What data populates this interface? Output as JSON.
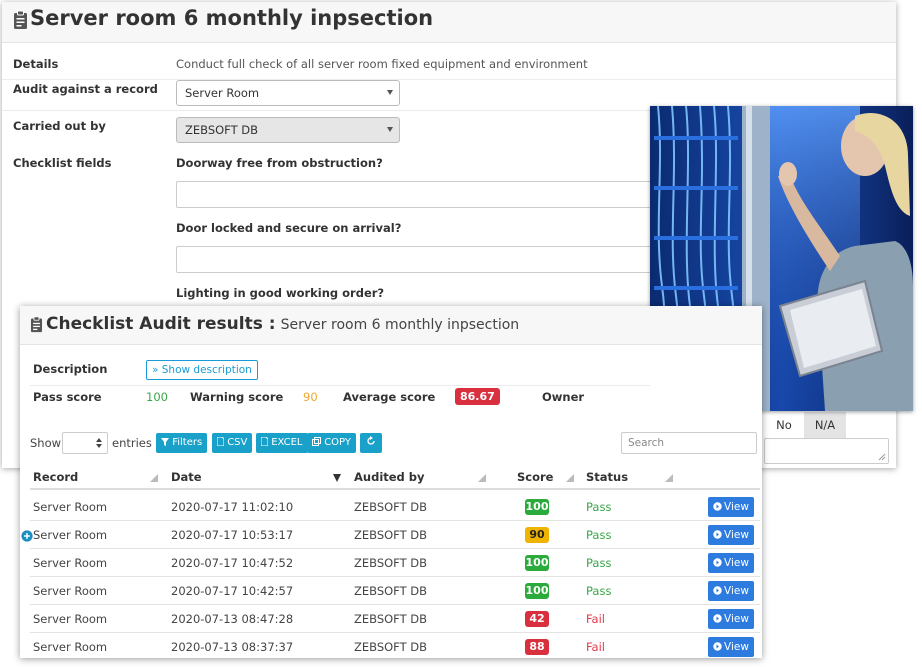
{
  "form": {
    "title": "Server room 6 monthly inpsection",
    "details_label": "Details",
    "details_value": "Conduct full check of all server room fixed equipment and environment",
    "audit_label": "Audit against a record",
    "audit_value": "Server Room",
    "carried_label": "Carried out by",
    "carried_value": "ZEBSOFT DB",
    "checklist_label": "Checklist fields",
    "q1": "Doorway free from obstruction?",
    "q2": "Door locked and secure on arrival?",
    "q3": "Lighting in good working order?",
    "no_label": "No",
    "na_label": "N/A"
  },
  "results": {
    "title": "Checklist Audit results :",
    "subtitle": "Server room 6 monthly inpsection",
    "description_label": "Description",
    "show_description": "» Show description",
    "pass_label": "Pass score",
    "pass_value": "100",
    "warning_label": "Warning score",
    "warning_value": "90",
    "average_label": "Average score",
    "average_value": "86.67",
    "owner_label": "Owner",
    "show_label": "Show",
    "entries_label": "entries",
    "filters": "Filters",
    "csv": "CSV",
    "excel": "EXCEL",
    "copy": "COPY",
    "search_placeholder": "Search",
    "columns": [
      "Record",
      "Date",
      "Audited by",
      "Score",
      "Status"
    ],
    "view_label": "View",
    "rows": [
      {
        "record": "Server Room",
        "date": "2020-07-17 11:02:10",
        "by": "ZEBSOFT DB",
        "score": "100",
        "status": "Pass"
      },
      {
        "record": "Server Room",
        "date": "2020-07-17 10:53:17",
        "by": "ZEBSOFT DB",
        "score": "90",
        "status": "Pass"
      },
      {
        "record": "Server Room",
        "date": "2020-07-17 10:47:52",
        "by": "ZEBSOFT DB",
        "score": "100",
        "status": "Pass"
      },
      {
        "record": "Server Room",
        "date": "2020-07-17 10:42:57",
        "by": "ZEBSOFT DB",
        "score": "100",
        "status": "Pass"
      },
      {
        "record": "Server Room",
        "date": "2020-07-13 08:47:28",
        "by": "ZEBSOFT DB",
        "score": "42",
        "status": "Fail"
      },
      {
        "record": "Server Room",
        "date": "2020-07-13 08:37:37",
        "by": "ZEBSOFT DB",
        "score": "88",
        "status": "Fail"
      }
    ]
  },
  "colors": {
    "pass_badge": "#2bab3c",
    "warn_badge": "#f0b400",
    "fail_badge": "#d9303f",
    "pass_text": "#3aa64a",
    "fail_text": "#e03c4a",
    "warning_text": "#f0a830",
    "teal_button": "#1aa1c9",
    "view_button": "#2e7be0"
  },
  "icons": [
    "clipboard-icon",
    "filter-icon",
    "file-icon",
    "copy-icon",
    "refresh-icon",
    "expand-plus-icon",
    "view-icon"
  ]
}
